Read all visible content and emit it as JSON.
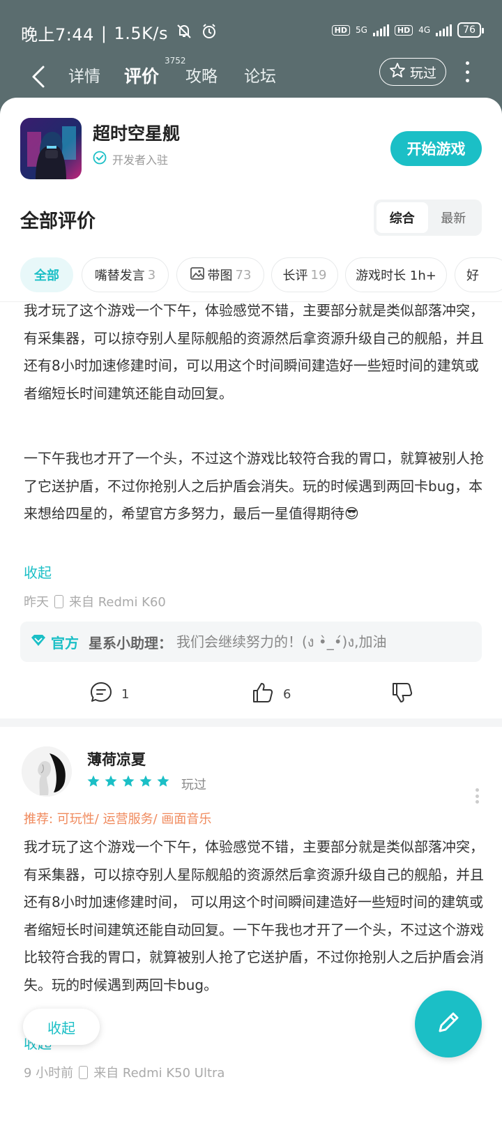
{
  "status_bar": {
    "time": "晚上7:44",
    "speed": "1.5K/s",
    "hd1": "HD",
    "net1": "5G",
    "hd2": "HD",
    "net2": "4G",
    "battery": "76"
  },
  "nav": {
    "tabs": [
      "详情",
      "评价",
      "攻略",
      "论坛"
    ],
    "review_count": "3752",
    "played_label": "玩过"
  },
  "game": {
    "name": "超时空星舰",
    "dev_status": "开发者入驻",
    "start_label": "开始游戏"
  },
  "reviews_header": {
    "title": "全部评价",
    "sort_options": [
      "综合",
      "最新"
    ]
  },
  "filters": [
    {
      "label": "全部",
      "count": ""
    },
    {
      "label": "嘴替发言",
      "count": "3"
    },
    {
      "label": "带图",
      "count": "73"
    },
    {
      "label": "长评",
      "count": "19"
    },
    {
      "label": "游戏时长 1h+",
      "count": ""
    },
    {
      "label": "好",
      "count": ""
    }
  ],
  "review1": {
    "para1": "我才玩了这个游戏一个下午，体验感觉不错，主要部分就是类似部落冲突，有采集器，可以掠夺别人星际舰船的资源然后拿资源升级自己的舰船，并且还有8小时加速修建时间，可以用这个时间瞬间建造好一些短时间的建筑或者缩短长时间建筑还能自动回复。",
    "para2": "一下午我也才开了一个头，不过这个游戏比较符合我的胃口，就算被别人抢了它送护盾，不过你抢别人之后护盾会消失。玩的时候遇到两回卡bug，本来想给四星的，希望官方多努力，最后一星值得期待😎",
    "collapse": "收起",
    "time": "昨天",
    "device": "来自 Redmi K60",
    "official_tag": "官方",
    "official_name": "星系小助理：",
    "official_msg": "我们会继续努力的！(ง •̀_•́)ง,加油",
    "comments": "1",
    "likes": "6"
  },
  "review2": {
    "username": "薄荷凉夏",
    "rating": 5,
    "played": "玩过",
    "recommend": "推荐: 可玩性/ 运营服务/ 画面音乐",
    "text": "我才玩了这个游戏一个下午，体验感觉不错，主要部分就是类似部落冲突， 有采集器，可以掠夺别人星际舰船的资源然后拿资源升级自己的舰船，并且还有8小时加速修建时间， 可以用这个时间瞬间建造好一些短时间的建筑或者缩短长时间建筑还能自动回复。一下午我也才开了一个头，不过这个游戏比较符合我的胃口，就算被别人抢了它送护盾，不过你抢别人之后护盾会消失。玩的时候遇到两回卡bug。",
    "collapse": "收起",
    "time": "9 小时前",
    "device": "来自 Redmi K50 Ultra"
  },
  "float": {
    "collapse": "收起"
  },
  "colors": {
    "accent": "#1bbfc6",
    "recommend": "#f08a5d",
    "status_bg": "#5b6d6f"
  }
}
